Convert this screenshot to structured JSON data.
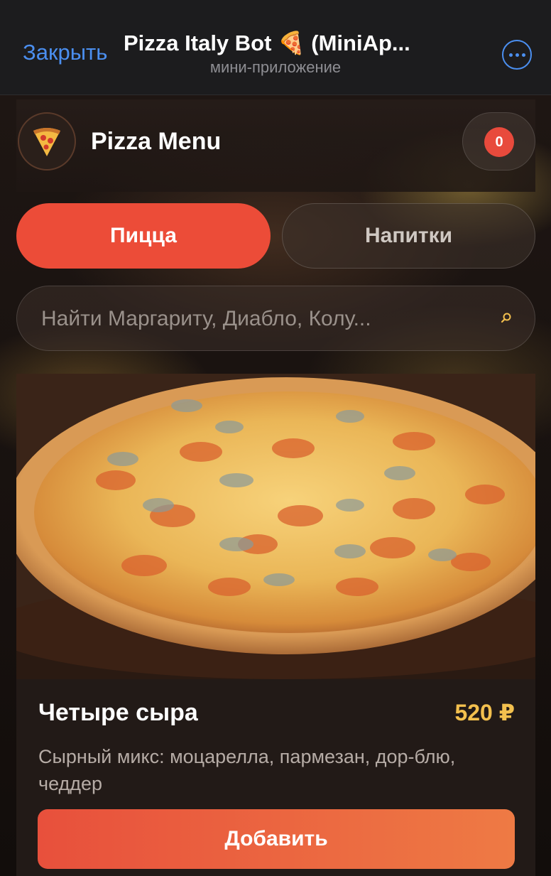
{
  "telegram_header": {
    "close_label": "Закрыть",
    "title": "Pizza Italy Bot 🍕 (MiniAp...",
    "subtitle": "мини-приложение",
    "more_icon": "more-dots-icon"
  },
  "app_header": {
    "title": "Pizza Menu",
    "logo_icon": "pizza-slice-icon",
    "cart_count": "0"
  },
  "tabs": [
    {
      "label": "Пицца",
      "active": true
    },
    {
      "label": "Напитки",
      "active": false
    }
  ],
  "search": {
    "placeholder": "Найти Маргариту, Диабло, Колу...",
    "icon": "search-icon"
  },
  "product": {
    "name": "Четыре сыра",
    "price": "520 ₽",
    "description": "Сырный микс: моцарелла, пармезан, дор-блю, чеддер",
    "add_label": "Добавить"
  },
  "colors": {
    "accent": "#ec4c38",
    "price": "#f3c04e",
    "link": "#4b8ff0",
    "badge": "#e84a3c"
  }
}
